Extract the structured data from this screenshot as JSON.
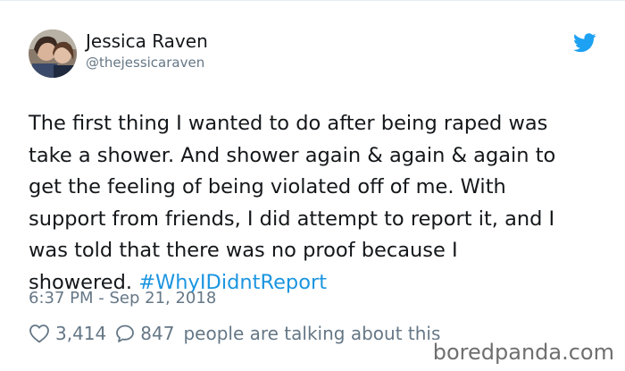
{
  "user": {
    "display_name": "Jessica Raven",
    "handle": "@thejessicaraven"
  },
  "tweet": {
    "lines": [
      "The first thing I wanted to do after being raped was",
      "take a shower. And shower again & again & again to",
      "get the feeling of being violated off of me. With",
      "support from friends, I did attempt to report it, and I",
      "was told that there was no proof because I"
    ],
    "last_line_text": "showered.",
    "hashtag": "#WhyIDidntReport",
    "timestamp": "6:37 PM - Sep 21, 2018"
  },
  "stats": {
    "likes": "3,414",
    "replies": "847",
    "talking_label": "people are talking about this"
  },
  "icons": {
    "bird": "twitter-bird-icon",
    "like": "heart-icon",
    "reply": "speech-bubble-icon"
  },
  "colors": {
    "link": "#1b95e0",
    "secondary": "#657786",
    "text": "#14171a"
  },
  "watermark": "boredpanda.com"
}
